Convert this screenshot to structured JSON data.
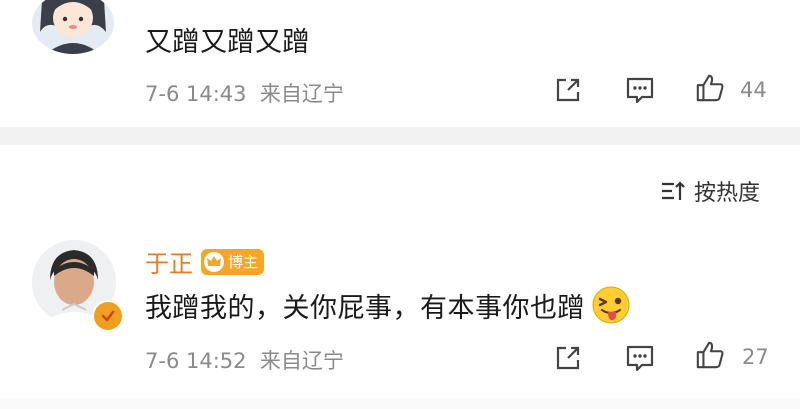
{
  "comments": [
    {
      "text": "又蹭又蹭又蹭",
      "time": "7-6 14:43",
      "location": "来自辽宁",
      "like_count": "44"
    },
    {
      "username": "于正",
      "badge": "博主",
      "text": "我蹭我的，关你屁事，有本事你也蹭",
      "time": "7-6 14:52",
      "location": "来自辽宁",
      "like_count": "27"
    }
  ],
  "sort": {
    "label": "按热度"
  },
  "icons": {
    "share": "share-icon",
    "comment": "comment-icon",
    "like": "thumbs-up-icon",
    "sort": "sort-icon",
    "verified": "verified-badge-icon",
    "crown": "crown-icon",
    "emoji": "tongue-wink-emoji"
  },
  "colors": {
    "username": "#ea7b1c",
    "badge": "#f5a623",
    "divider": "#f2f2f2",
    "meta": "#8a8a8a",
    "verified": "#f0a020"
  }
}
